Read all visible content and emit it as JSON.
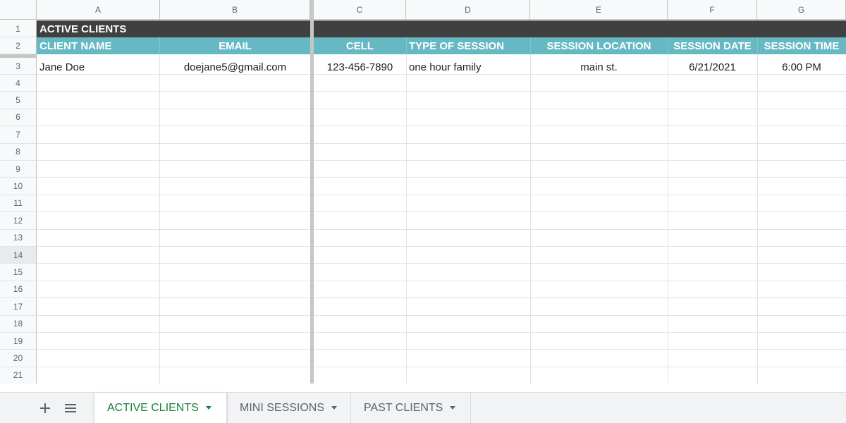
{
  "columns": [
    "A",
    "B",
    "C",
    "D",
    "E",
    "F",
    "G"
  ],
  "row_numbers": [
    "1",
    "2",
    "3",
    "4",
    "5",
    "6",
    "7",
    "8",
    "9",
    "10",
    "11",
    "12",
    "13",
    "14",
    "15",
    "16",
    "17",
    "18",
    "19",
    "20",
    "21"
  ],
  "title": "ACTIVE CLIENTS",
  "headers": [
    "CLIENT NAME",
    "EMAIL",
    "CELL",
    "TYPE OF SESSION",
    "SESSION LOCATION",
    "SESSION DATE",
    "SESSION TIME"
  ],
  "rows": [
    [
      "Jane Doe",
      "doejane5@gmail.com",
      "123-456-7890",
      "one hour family",
      "main st.",
      "6/21/2021",
      "6:00 PM"
    ]
  ],
  "tabs": [
    {
      "label": "ACTIVE CLIENTS",
      "active": true
    },
    {
      "label": "MINI SESSIONS",
      "active": false
    },
    {
      "label": "PAST CLIENTS",
      "active": false
    }
  ],
  "icons": {
    "add_sheet": "plus-icon",
    "all_sheets": "list-icon"
  },
  "colors": {
    "title_bg": "#404040",
    "header_bg": "#66b9c3",
    "active_tab": "#188038"
  }
}
